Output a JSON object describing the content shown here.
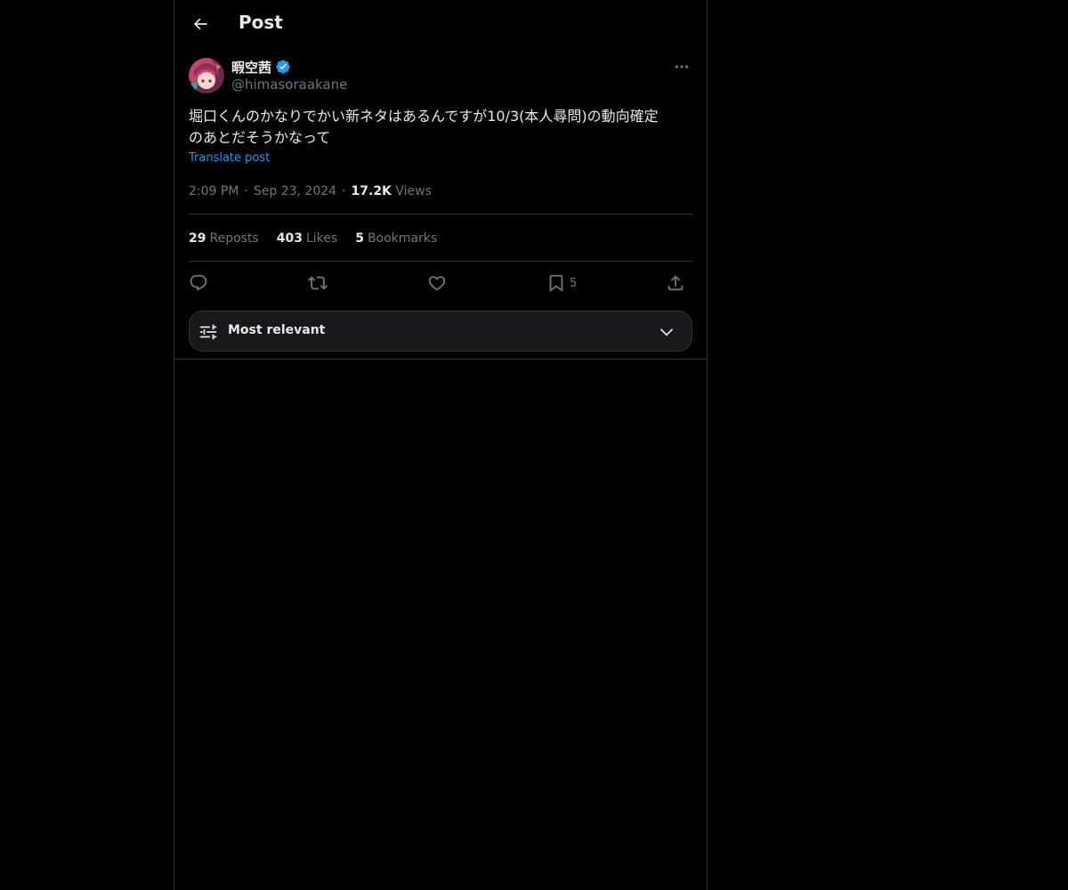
{
  "header": {
    "title": "Post",
    "back_icon": "arrow-left-icon"
  },
  "author": {
    "display_name": "暇空茜",
    "handle": "@himasoraakane",
    "verified": true,
    "verified_color": "#1d9bf0"
  },
  "post": {
    "text": "堀口くんのかなりでかい新ネタはあるんですが10/3(本人尋問)の動向確定\nのあとだそうかなって",
    "translate_label": "Translate post",
    "time": "2:09 PM",
    "date": "Sep 23, 2024",
    "views_count": "17.2K",
    "views_label": "Views",
    "separator": "·"
  },
  "stats": {
    "reposts_count": "29",
    "reposts_label": "Reposts",
    "likes_count": "403",
    "likes_label": "Likes",
    "bookmarks_count": "5",
    "bookmarks_label": "Bookmarks"
  },
  "actions": {
    "reply_icon": "reply-icon",
    "repost_icon": "repost-icon",
    "like_icon": "heart-icon",
    "bookmark_icon": "bookmark-icon",
    "bookmark_count": "5",
    "share_icon": "share-icon"
  },
  "sort": {
    "label": "Most relevant",
    "icon": "sliders-icon",
    "chevron": "chevron-down-icon"
  },
  "colors": {
    "background": "#000000",
    "text": "#e7e9ea",
    "muted": "#71767b",
    "accent": "#1d9bf0",
    "border": "#2f3336"
  }
}
